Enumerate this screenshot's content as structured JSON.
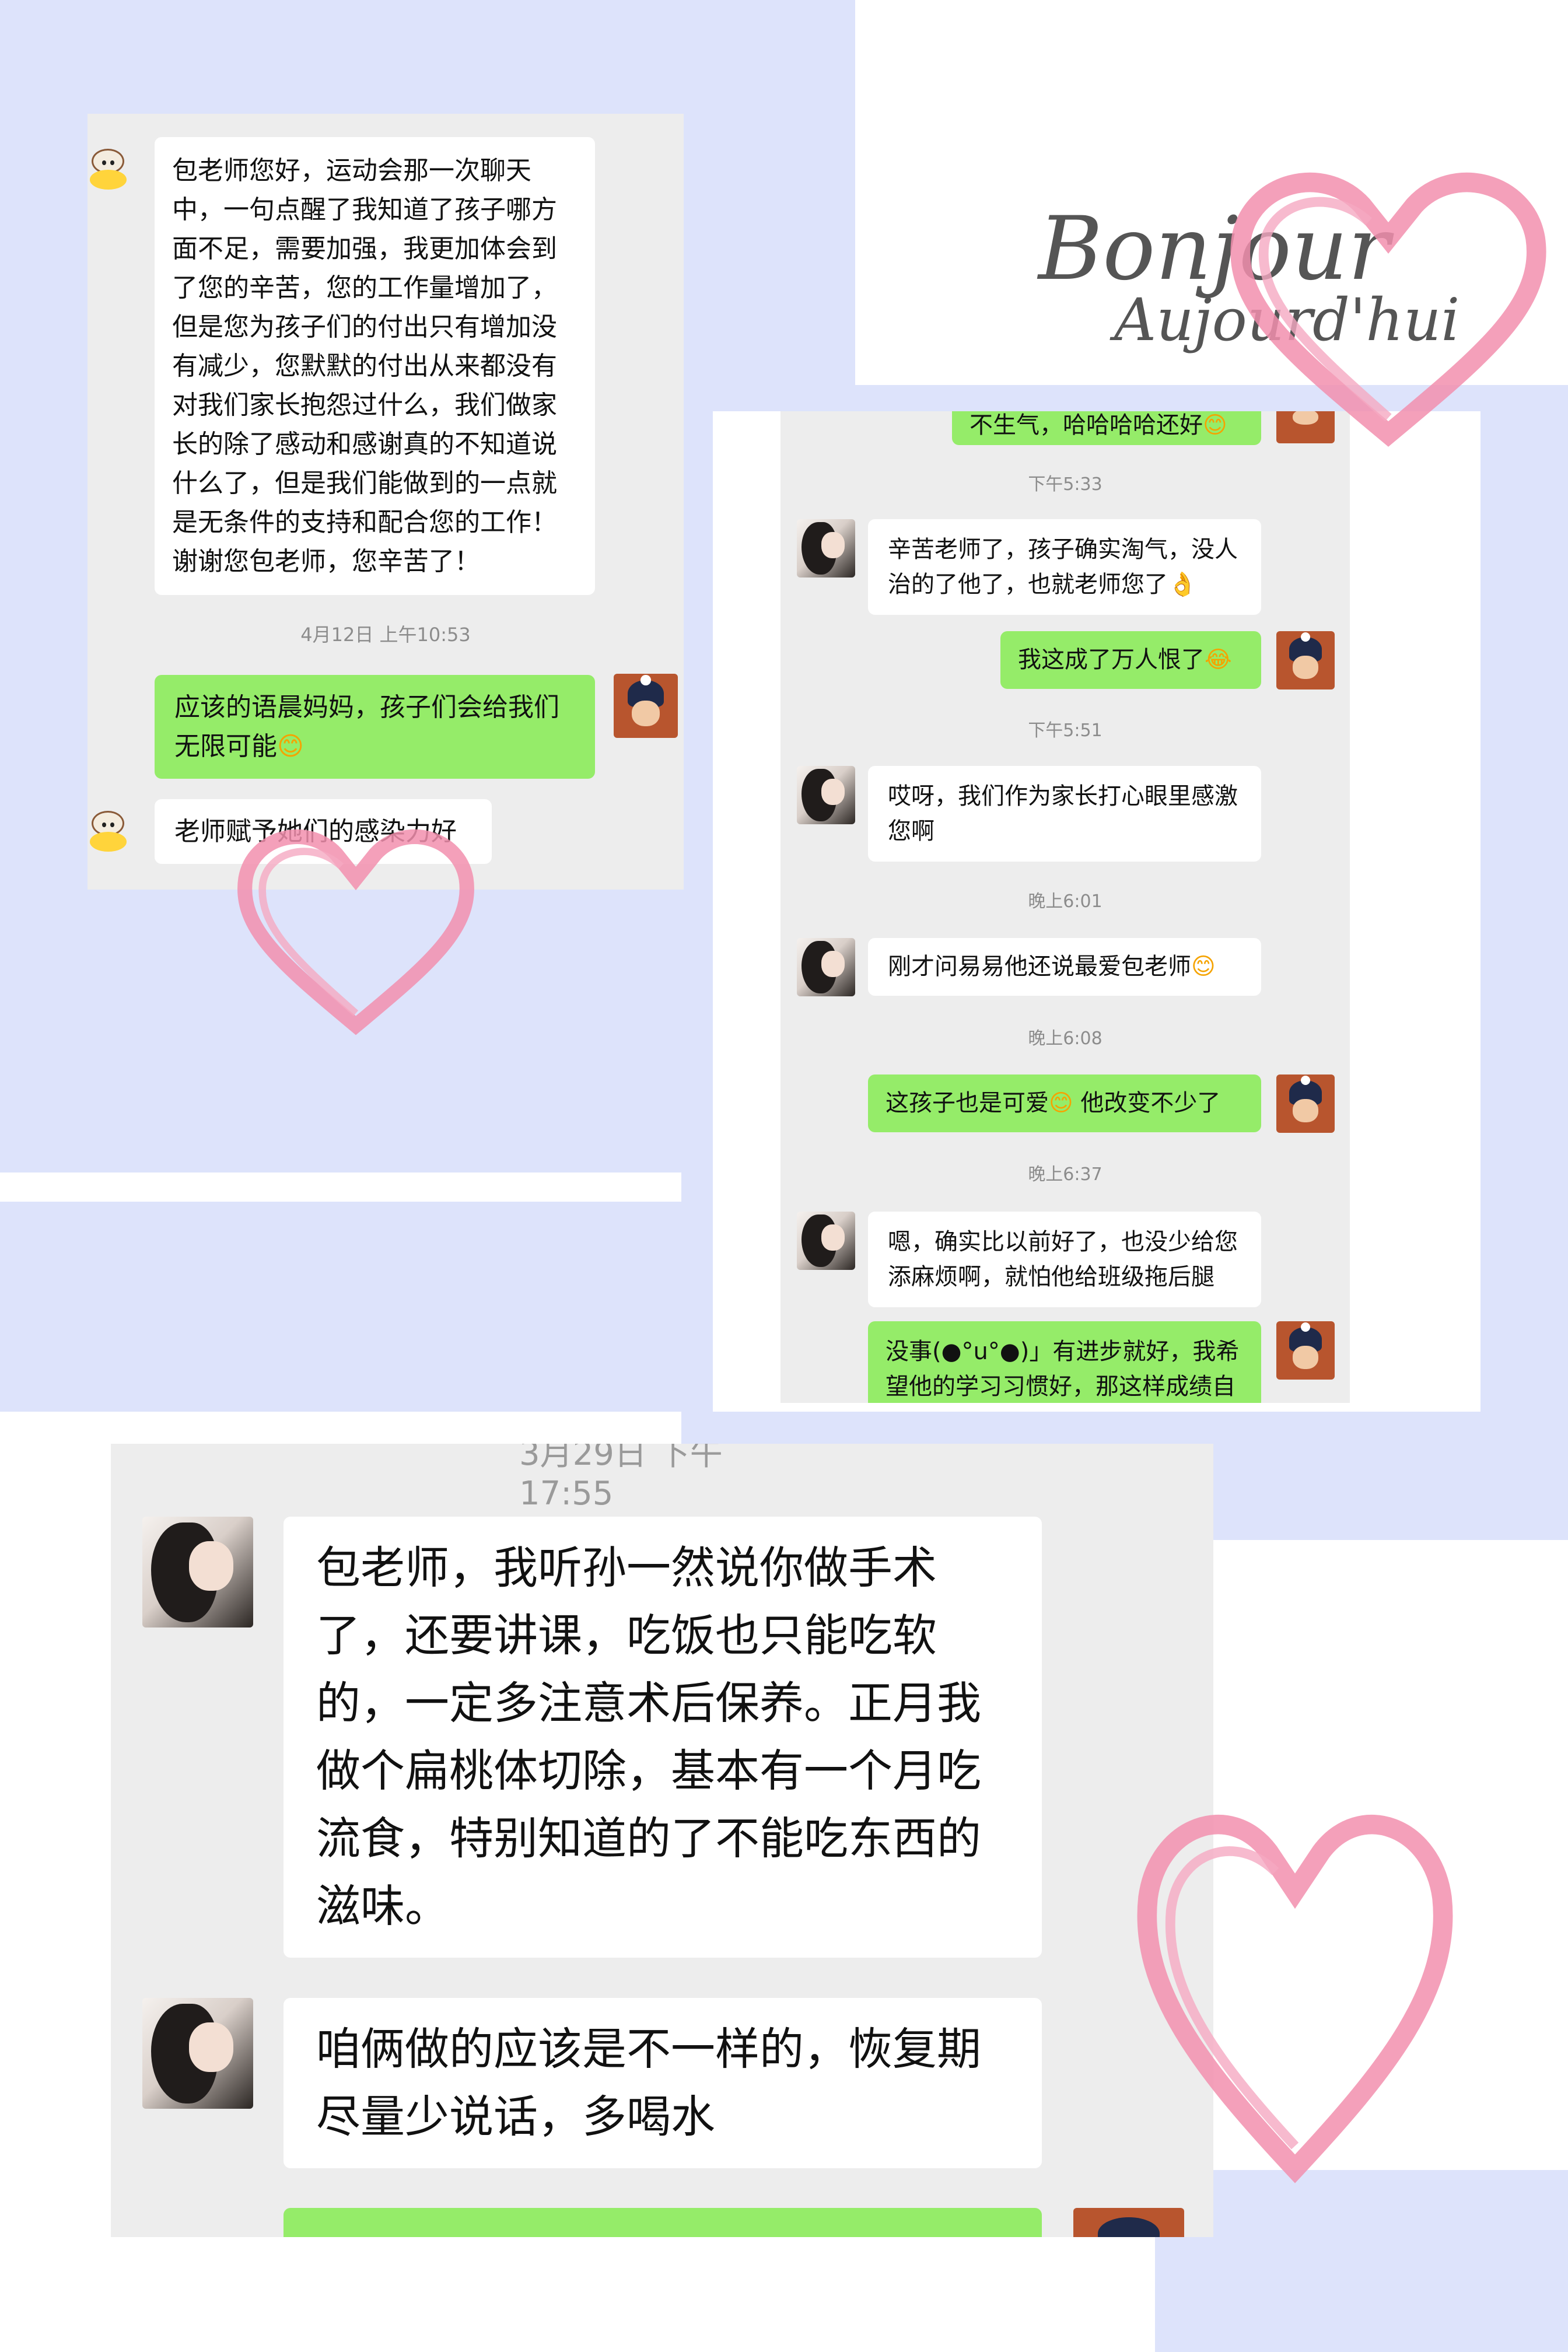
{
  "decoration": {
    "title_line1": "Bonjour",
    "title_line2": "Aujourd'hui",
    "bg_color": "#dde3fb",
    "heart_color": "#f28fae"
  },
  "chat1": {
    "messages": [
      {
        "side": "left",
        "avatar": "monkey-avatar",
        "text": "包老师您好，运动会那一次聊天中，一句点醒了我知道了孩子哪方面不足，需要加强，我更加体会到了您的辛苦，您的工作量增加了，但是您为孩子们的付出只有增加没有减少，您默默的付出从来都没有对我们家长抱怨过什么，我们做家长的除了感动和感谢真的不知道说什么了，但是我们能做到的一点就是无条件的支持和配合您的工作！谢谢您包老师，您辛苦了！"
      },
      {
        "timestamp": "4月12日 上午10:53"
      },
      {
        "side": "right",
        "avatar": "teacher-avatar",
        "text": "应该的语晨妈妈，孩子们会给我们无限可能",
        "emoji": "😊"
      },
      {
        "side": "left",
        "avatar": "monkey-avatar",
        "text": "老师赋予她们的感染力好"
      }
    ]
  },
  "chat2": {
    "clipped_top": "不生气，哈哈哈哈还好",
    "clipped_top_emoji": "😊",
    "messages": [
      {
        "timestamp": "下午5:33"
      },
      {
        "side": "left",
        "text": "辛苦老师了，孩子确实淘气，没人治的了他了，也就老师您了",
        "emoji": "👌"
      },
      {
        "side": "right",
        "text": "我这成了万人恨了",
        "emoji": "😂"
      },
      {
        "timestamp": "下午5:51"
      },
      {
        "side": "left",
        "text": "哎呀，我们作为家长打心眼里感激您啊"
      },
      {
        "timestamp": "晚上6:01"
      },
      {
        "side": "left",
        "text": "刚才问易易他还说最爱包老师",
        "emoji": "😊"
      },
      {
        "timestamp": "晚上6:08"
      },
      {
        "side": "right",
        "text": "这孩子也是可爱",
        "emoji": "😊",
        "text2": " 他改变不少了"
      },
      {
        "timestamp": "晚上6:37"
      },
      {
        "side": "left",
        "text": "嗯，确实比以前好了，也没少给您添麻烦啊，就怕他给班级拖后腿"
      },
      {
        "side": "right",
        "text": "没事(●°u°●)」有进步就好，我希望他的学习习惯好，那这样成绩自"
      }
    ]
  },
  "chat3": {
    "clipped_timestamp": "3月29日 下午17:55",
    "messages": [
      {
        "side": "left",
        "text": "包老师，我听孙一然说你做手术了，还要讲课，吃饭也只能吃软的，一定多注意术后保养。正月我做个扁桃体切除，基本有一个月吃流食，特别知道的了不能吃东西的滋味。"
      },
      {
        "side": "left",
        "text": "咱俩做的应该是不一样的，恢复期尽量少说话，多喝水"
      }
    ]
  }
}
